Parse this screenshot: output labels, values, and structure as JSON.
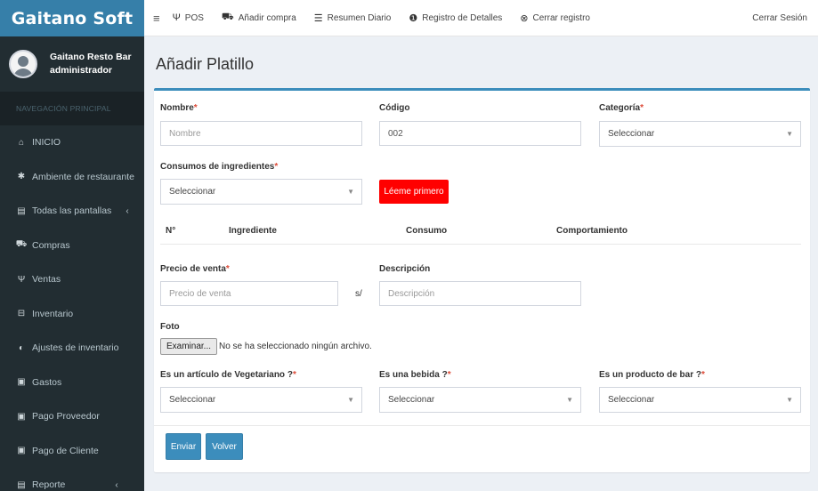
{
  "sidebar": {
    "brand": "Gaitano Soft",
    "user": {
      "name": "Gaitano Resto Bar",
      "role": "administrador"
    },
    "header": "NAVEGACIÓN PRINCIPAL",
    "items": [
      {
        "label": "INICIO",
        "icon": "home-icon",
        "glyph": "⌂"
      },
      {
        "label": "Ambiente de restaurante",
        "icon": "gear-icon",
        "glyph": "✱"
      },
      {
        "label": "Todas las pantallas",
        "icon": "file-icon",
        "glyph": "▤",
        "caret": "‹"
      },
      {
        "label": "Compras",
        "icon": "cart-icon",
        "glyph": "⛟"
      },
      {
        "label": "Ventas",
        "icon": "cutlery-icon",
        "glyph": "Ψ"
      },
      {
        "label": "Inventario",
        "icon": "inbox-icon",
        "glyph": "⊟"
      },
      {
        "label": "Ajustes de inventario",
        "icon": "adjust-icon",
        "glyph": "◐"
      },
      {
        "label": "Gastos",
        "icon": "money-icon",
        "glyph": "▣"
      },
      {
        "label": "Pago Proveedor",
        "icon": "money-icon",
        "glyph": "▣"
      },
      {
        "label": "Pago de Cliente",
        "icon": "money-icon",
        "glyph": "▣"
      },
      {
        "label": "Reporte",
        "icon": "file-icon",
        "glyph": "▤",
        "caret": "‹"
      }
    ]
  },
  "topbar": {
    "toggle": "≡",
    "items": [
      {
        "label": "POS",
        "glyph": "Ψ"
      },
      {
        "label": "Añadir compra",
        "glyph": "⛟"
      },
      {
        "label": "Resumen Diario",
        "glyph": "☰"
      },
      {
        "label": "Registro de Detalles",
        "glyph": "❶"
      },
      {
        "label": "Cerrar registro",
        "glyph": "⊗"
      }
    ],
    "logout": "Cerrar Sesión"
  },
  "page": {
    "title": "Añadir Platillo",
    "required_mark": "*",
    "nombre": {
      "label": "Nombre",
      "placeholder": "Nombre"
    },
    "codigo": {
      "label": "Código",
      "value": "002"
    },
    "categoria": {
      "label": "Categoría",
      "selected": "Seleccionar"
    },
    "consumos": {
      "label": "Consumos de ingredientes",
      "selected": "Seleccionar"
    },
    "leeme_button": "Léeme primero",
    "table_headers": {
      "num": "N°",
      "ingrediente": "Ingrediente",
      "consumo": "Consumo",
      "comportamiento": "Comportamiento"
    },
    "precio": {
      "label": "Precio de venta",
      "placeholder": "Precio de venta",
      "suffix": "s/"
    },
    "descripcion": {
      "label": "Descripción",
      "placeholder": "Descripción"
    },
    "foto": {
      "label": "Foto",
      "button": "Examinar...",
      "status": "No se ha seleccionado ningún archivo."
    },
    "vegetariano": {
      "label": "Es un artículo de Vegetariano ?",
      "selected": "Seleccionar"
    },
    "bebida": {
      "label": "Es una bebida ?",
      "selected": "Seleccionar"
    },
    "bar": {
      "label": "Es un producto de bar ?",
      "selected": "Seleccionar"
    },
    "submit_button": "Enviar",
    "back_button": "Volver"
  },
  "colors": {
    "sidebar": "#222d32",
    "brand": "#367fa9",
    "primary": "#3c8dbc",
    "danger": "#ff0000"
  }
}
